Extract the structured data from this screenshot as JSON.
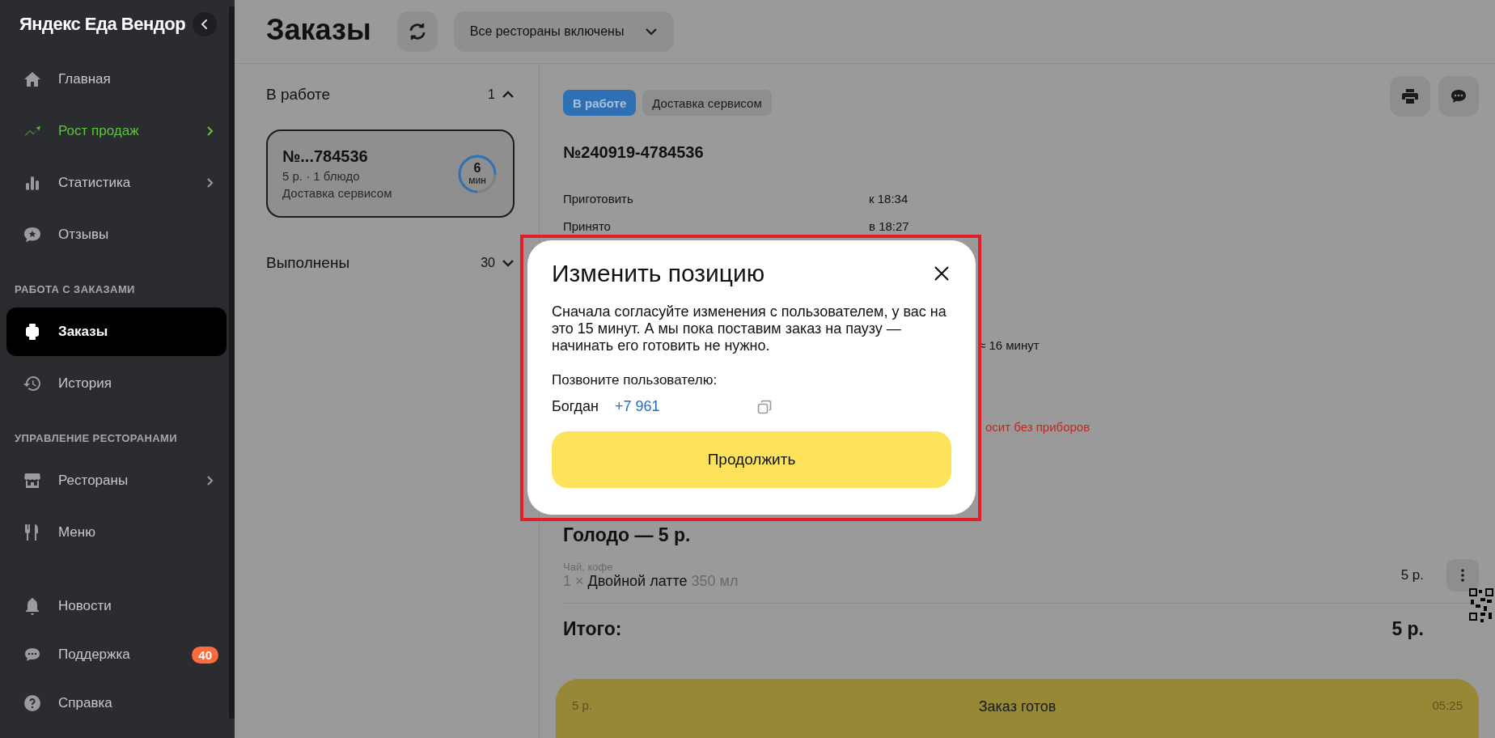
{
  "sidebar": {
    "logo": "Яндекс Еда Вендор",
    "sections": [
      {
        "items": [
          {
            "label": "Главная",
            "selected": false,
            "highlighted": false,
            "submenu": false
          },
          {
            "label": "Рост продаж",
            "selected": false,
            "highlighted": true,
            "submenu": true
          },
          {
            "label": "Статистика",
            "selected": false,
            "highlighted": false,
            "submenu": true
          },
          {
            "label": "Отзывы",
            "selected": false,
            "highlighted": false,
            "submenu": false
          }
        ]
      },
      {
        "heading": "РАБОТА С ЗАКАЗАМИ",
        "items": [
          {
            "label": "Заказы",
            "selected": true,
            "highlighted": false,
            "submenu": false
          },
          {
            "label": "История",
            "selected": false,
            "highlighted": false,
            "submenu": false
          }
        ]
      },
      {
        "heading": "УПРАВЛЕНИЕ РЕСТОРАНАМИ",
        "items": [
          {
            "label": "Рестораны",
            "selected": false,
            "highlighted": false,
            "submenu": true
          },
          {
            "label": "Меню",
            "selected": false,
            "highlighted": false,
            "submenu": false
          }
        ]
      },
      {
        "items": [
          {
            "label": "Новости",
            "selected": false,
            "highlighted": false,
            "submenu": false
          },
          {
            "label": "Поддержка",
            "selected": false,
            "highlighted": false,
            "submenu": false,
            "badge": "40"
          },
          {
            "label": "Справка",
            "selected": false,
            "highlighted": false,
            "submenu": false
          }
        ]
      }
    ]
  },
  "header": {
    "title": "Заказы",
    "restaurant_filter": "Все рестораны включены"
  },
  "order_groups": [
    {
      "title": "В работе",
      "count": "1",
      "expanded": true,
      "orders": [
        {
          "number": "№...784536",
          "summary": "5 р. · 1 блюдо",
          "delivery": "Доставка сервисом",
          "timer": "6",
          "timer_unit": "мин",
          "level": 0.75
        }
      ]
    },
    {
      "title": "Выполнены",
      "count": "30",
      "expanded": false
    }
  ],
  "order": {
    "tags": [
      {
        "label": "В работе",
        "kind": "status"
      },
      {
        "label": "Доставка сервисом",
        "kind": "plain"
      }
    ],
    "number": "№240919-4784536",
    "details": [
      {
        "label": "Приготовить",
        "value": "к 18:34"
      },
      {
        "label": "Принято",
        "value": "в 18:27"
      }
    ],
    "partial_texts": [
      {
        "text": "≈ 16 минут",
        "kind": "plain"
      },
      {
        "text": "осит без приборов",
        "kind": "warning"
      }
    ],
    "group_title": "Голодо — 5 р.",
    "items": [
      {
        "category": "Чай, кофе",
        "quantity": "1 ×",
        "name": "Двойной латте",
        "size": "350 мл",
        "price": "5 р."
      }
    ],
    "total_label": "Итого:",
    "total": "5 р.",
    "ready_button": {
      "price": "5 р.",
      "label": "Заказ готов",
      "time": "05:25"
    }
  },
  "modal": {
    "title": "Изменить позицию",
    "text": "Сначала согласуйте изменения с пользователем, у вас на это 15 минут. А мы пока поставим заказ на паузу — начинать его готовить не нужно.",
    "call_label": "Позвоните пользователю:",
    "customer": "Богдан",
    "phone": "+7 961",
    "button": "Продолжить"
  }
}
